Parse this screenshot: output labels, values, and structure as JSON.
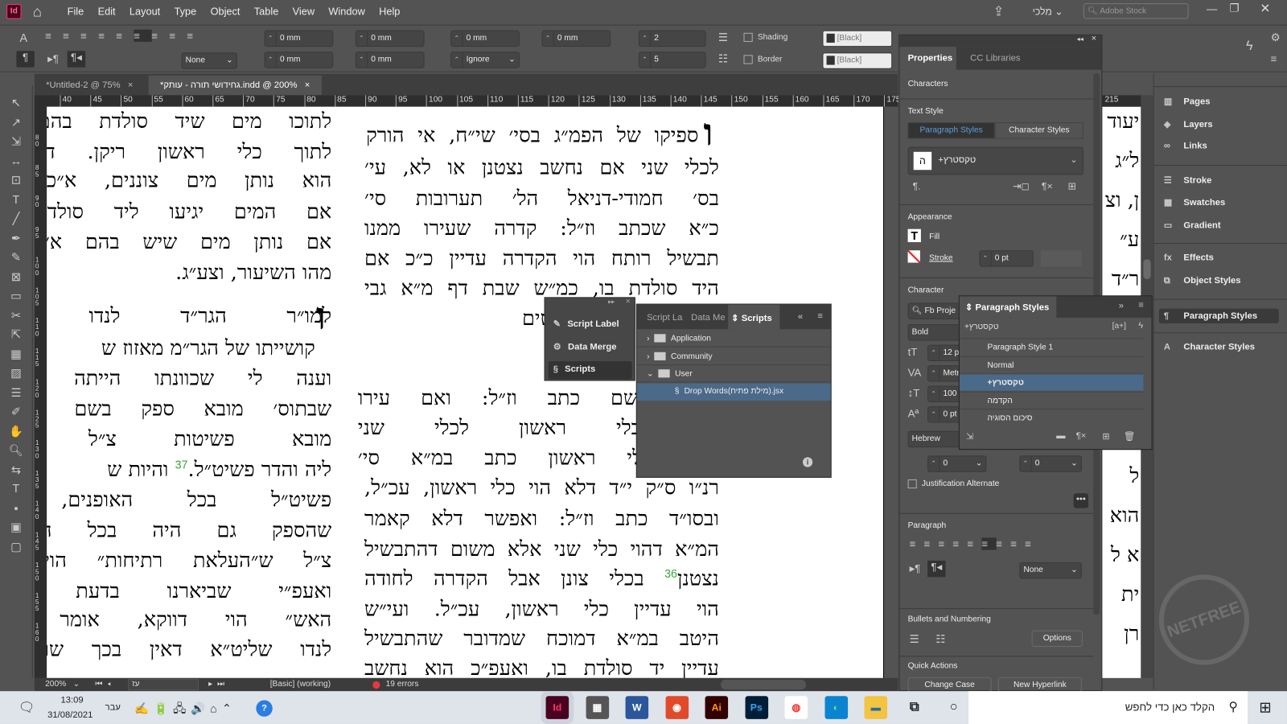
{
  "app": {
    "logo": "Id",
    "menu": [
      "File",
      "Edit",
      "Layout",
      "Type",
      "Object",
      "Table",
      "View",
      "Window",
      "Help"
    ],
    "workspace": "מלכי",
    "stock_search_placeholder": "Adobe Stock"
  },
  "control": {
    "indent_left": "0 mm",
    "indent_right": "0 mm",
    "space_before": "0 mm",
    "space_after": "0 mm",
    "first_line": "0 mm",
    "last_line": "0 mm",
    "align_grid": "Ignore",
    "kashida": "None",
    "drop_lines": "2",
    "drop_chars": "5",
    "shading_label": "Shading",
    "border_label": "Border",
    "shading_color": "[Black]",
    "border_color": "[Black]"
  },
  "tabs": [
    {
      "label": "*Untitled-2 @ 75%",
      "active": false
    },
    {
      "label": "*גחידושי תורה - עותק.indd @ 200%",
      "active": true
    }
  ],
  "ruler": [
    "40",
    "45",
    "50",
    "55",
    "60",
    "65",
    "70",
    "75",
    "80",
    "85",
    "90",
    "95",
    "100",
    "105",
    "110",
    "115",
    "120",
    "125",
    "130",
    "135",
    "140",
    "145",
    "150",
    "155",
    "160",
    "165",
    "170",
    "175"
  ],
  "ruler_right": [
    "215"
  ],
  "vruler": [
    "80",
    "85",
    "90",
    "95",
    "100",
    "105",
    "110",
    "115",
    "120",
    "125",
    "130",
    "135",
    "140",
    "145",
    "150",
    "155",
    "160"
  ],
  "page": {
    "left_col": [
      "לתוכו מים שיד סולדת בהם מס",
      "לתוך כלי ראשון ריקן. דבשלמא",
      "הוא נותן מים צוננים, א״כ השי",
      "אם המים יגיעו ליד סולדת או",
      "אם נותן מים שיש בהם א״כ לא",
      "מהו השיעור, וצע״ג.",
      "למו״ר הגר״ד לנדו שליט",
      "קושייתו של הגר״מ מאזוז ש",
      "וענה לי שכוונתו הייתה אחרת,",
      "שבתוס׳ מובא ספק בשם ר״י ו",
      "מובא פשיטות צ״ל שהר״",
      "ליה והדר פשיט״ל.",
      "פשיט״ל בכל האופנים, א״",
      "שהספק גם היה בכל האופנים",
      "צ״ל ש״העלאת רתיחות״ הוי לאו",
      "ואעפ״י שביארנו בדעת המ״ב",
      "האש״ הוי דווקא, אומר מו״ר",
      "לנדו שליט״א דאין בכך שום קו"
    ],
    "left_after_37": "והיות ש",
    "footnote_37": "37",
    "right_col": [
      "ספיקו של הפמ״ג בסי׳ שי״ח, אי הורק",
      "לכלי שני אם נחשב נצטנן או לא, עי׳",
      "בס׳ חמודי-דניאל הל׳ תערובות סי׳",
      "כ״א שכתב וז״ל: קדרה שעירו ממנו",
      "תבשיל רותח הוי הקדרה עדיין כ״כ אם",
      "היד סולדת בו, כמ״ש שבת דף מ״א גבי",
      "לתוכו מים מועטים",
      "״ב שם כתב וז״ל: ואם עירו",
      "מכלי ראשון לכלי שני",
      "לכלי ראשון כתב במ״א סי׳",
      "רנ״ו ס״ק י״ד דלא הוי כלי ראשון, עכ״ל,",
      "ובסו״ד כתב וז״ל: ואפשר דלא קאמר",
      "המ״א דהוי כלי שני אלא משום דהתבשיל",
      "נצטנן",
      "הוי עדיין כלי ראשון, עכ״ל. ועי״ש",
      "היטב במ״א דמוכח שמדובר שהתבשיל",
      "עדיין יד סולדת בו, ואעפ״כ הוא נחשב"
    ],
    "right_after_36": "בכלי צונן אבל הקדרה לחודה",
    "footnote_36": "36",
    "drop_cap": "ו",
    "far_col": [
      "יעוד",
      "ל״ג",
      "ן, וצ",
      "ע״",
      "ר״ד",
      "שי",
      "צות",
      "שהרי",
      "ת ל",
      "ל",
      "הוא",
      "א ל",
      "ית",
      "רן"
    ]
  },
  "scripts_mini": {
    "items": [
      "Script Label",
      "Data Merge",
      "Scripts"
    ]
  },
  "scripts_panel": {
    "tabs": [
      "Script La",
      "Data Me",
      "Scripts"
    ],
    "tree": [
      {
        "label": "Application",
        "expanded": false
      },
      {
        "label": "Community",
        "expanded": false
      },
      {
        "label": "User",
        "expanded": true
      }
    ],
    "file": "Drop Words(מילת פתיח).jsx"
  },
  "properties": {
    "tabs": [
      "Properties",
      "CC Libraries"
    ],
    "characters": "Characters",
    "text_style": "Text Style",
    "style_tabs": [
      "Paragraph Styles",
      "Character Styles"
    ],
    "current_style": "טקסטרץ+",
    "style_preview": "ה",
    "appearance": "Appearance",
    "fill": "Fill",
    "stroke": "Stroke",
    "stroke_weight": "0 pt",
    "character": "Character",
    "font": "Fb Proje",
    "font_style": "Bold",
    "size": "12 pt",
    "kerning": "Metr",
    "leading": "100",
    "baseline": "0 pt",
    "language": "Hebrew",
    "diacritic_x": "0",
    "diacritic_y": "0",
    "justification_alternate": "Justification Alternate",
    "paragraph": "Paragraph",
    "kashida": "None",
    "bullets": "Bullets and Numbering",
    "options": "Options",
    "quick_actions": "Quick Actions",
    "change_case": "Change Case",
    "new_hyperlink": "New Hyperlink"
  },
  "para_styles_panel": {
    "title": "Paragraph Styles",
    "current": "טקסטרץ+",
    "items": [
      "Paragraph Style 1",
      "Normal",
      "טקסטרץ+",
      "הקדמה",
      "סיכום הסוגיה"
    ],
    "selected_index": 2
  },
  "dock": {
    "groups": [
      [
        "Pages",
        "Layers",
        "Links"
      ],
      [
        "Stroke",
        "Swatches",
        "Gradient"
      ],
      [
        "Effects",
        "Object Styles"
      ],
      [
        "Paragraph Styles"
      ],
      [
        "Character Styles"
      ]
    ]
  },
  "status": {
    "zoom": "200%",
    "page": "עז",
    "preflight_profile": "[Basic] (working)",
    "errors": "19 errors",
    "error_color": "#e8383d"
  },
  "taskbar": {
    "time": "13:09",
    "date": "31/08/2021",
    "lang": "עבר",
    "search_placeholder": "הקלד כאן כדי לחפש",
    "notif_count": "3",
    "apps": [
      "Id",
      "Calculator",
      "Word",
      "Paint",
      "Ai",
      "Ps",
      "Chrome",
      "Edge",
      "Explorer"
    ]
  },
  "colors": {
    "accent": "#4b6a8a",
    "indesign": "#49021f",
    "footnote": "#3aa83a"
  }
}
